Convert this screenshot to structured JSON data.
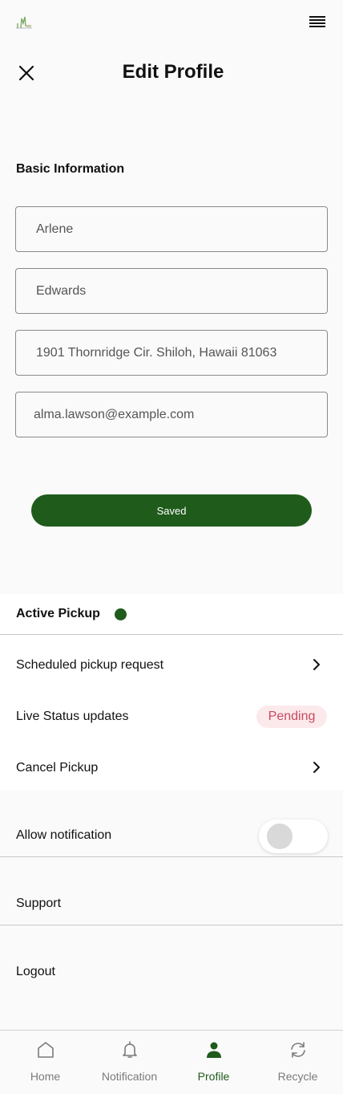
{
  "header": {
    "title": "Edit Profile"
  },
  "basic_info": {
    "section_title": "Basic Information",
    "first_name": "Arlene",
    "last_name": "Edwards",
    "address": "1901 Thornridge Cir. Shiloh, Hawaii 81063",
    "email": "alma.lawson@example.com"
  },
  "save_button": {
    "label": "Saved"
  },
  "active_pickup": {
    "title": "Active Pickup",
    "status_color": "#1f5b1b",
    "items": [
      {
        "label": "Scheduled pickup request"
      },
      {
        "label": "Live Status updates",
        "badge": "Pending"
      },
      {
        "label": "Cancel Pickup"
      }
    ]
  },
  "settings": {
    "allow_notification": {
      "label": "Allow notification",
      "enabled": false
    },
    "support_label": "Support",
    "logout_label": "Logout"
  },
  "bottom_nav": {
    "items": [
      {
        "label": "Home",
        "icon": "home-icon"
      },
      {
        "label": "Notification",
        "icon": "bell-icon"
      },
      {
        "label": "Profile",
        "icon": "person-icon",
        "active": true
      },
      {
        "label": "Recycle",
        "icon": "recycle-icon"
      }
    ]
  },
  "colors": {
    "accent": "#1f5b1b",
    "pending_text": "#c94a5e",
    "pending_bg": "#fce9ec"
  }
}
